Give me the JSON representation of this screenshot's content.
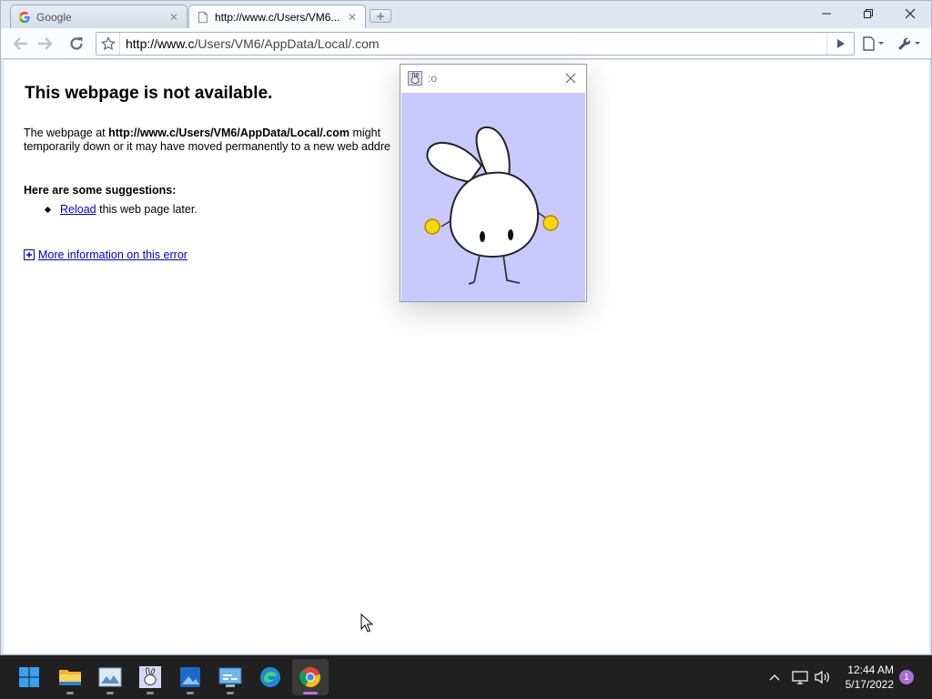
{
  "browser": {
    "tabs": [
      {
        "label": "Google",
        "icon": "google-icon",
        "active": false
      },
      {
        "label": "http://www.c/Users/VM6...",
        "icon": "page-icon",
        "active": true
      }
    ],
    "url_host": "http://www.c",
    "url_path": "/Users/VM6/AppData/Local/.com"
  },
  "error_page": {
    "title": "This webpage is not available.",
    "desc_prefix": "The webpage at ",
    "desc_url": "http://www.c/Users/VM6/AppData/Local/.com",
    "desc_line1_suffix": " might",
    "desc_line2": "temporarily down or it may have moved permanently to a new web addre",
    "suggestions_title": "Here are some suggestions:",
    "reload_link": "Reload",
    "reload_suffix": " this web page later.",
    "more_info": "More information on this error",
    "link_color": "#0000cc"
  },
  "popup": {
    "title": ":o",
    "background": "#c9c9ff"
  },
  "taskbar": {
    "apps": [
      "start-icon",
      "file-explorer-icon",
      "photo-viewer-icon",
      "bunny-app-icon",
      "photos-icon",
      "control-panel-icon",
      "edge-icon",
      "chrome-icon"
    ],
    "time": "12:44 AM",
    "date": "5/17/2022",
    "notifications": "1",
    "accent": "#c66bd6"
  }
}
